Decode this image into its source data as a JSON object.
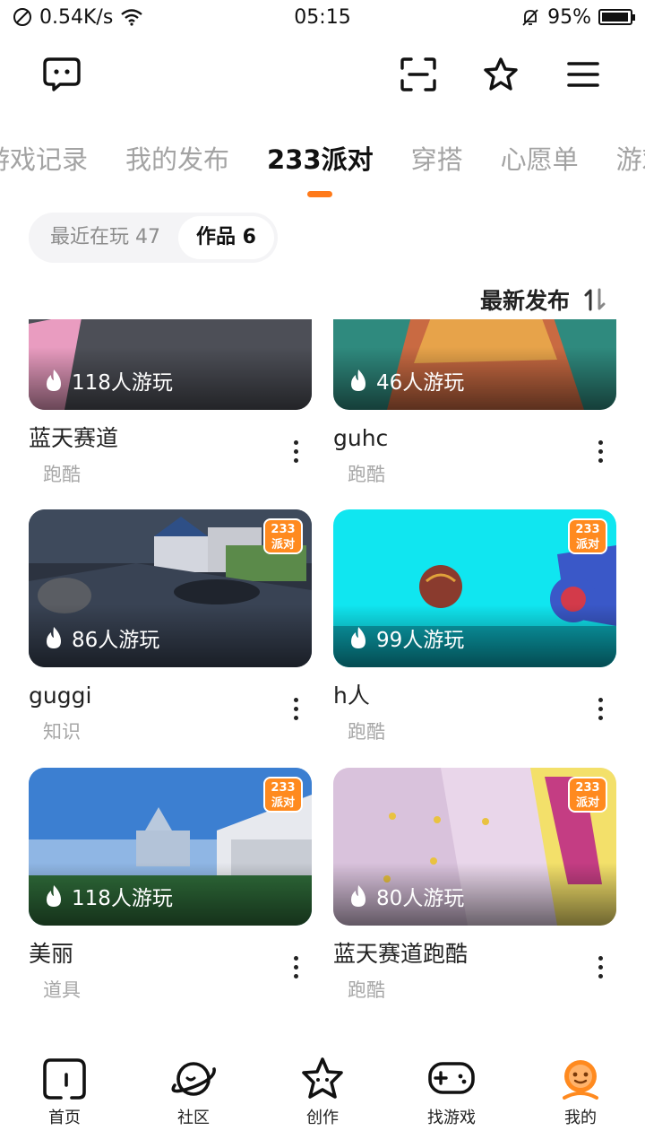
{
  "status": {
    "net_speed": "0.54K/s",
    "time": "05:15",
    "battery_pct": "95%",
    "battery_level": 0.95
  },
  "tabs": [
    {
      "label": "游戏记录",
      "active": false
    },
    {
      "label": "我的发布",
      "active": false
    },
    {
      "label": "233派对",
      "active": true
    },
    {
      "label": "穿搭",
      "active": false
    },
    {
      "label": "心愿单",
      "active": false
    },
    {
      "label": "游戏",
      "active": false
    }
  ],
  "segment": {
    "recent": "最近在玩 47",
    "works": "作品 6"
  },
  "sort": {
    "label": "最新发布"
  },
  "badge": {
    "line1": "233",
    "line2": "派对"
  },
  "cards": [
    {
      "title": "蓝天赛道",
      "tag": "跑酷",
      "plays": "118人游玩",
      "badge": false
    },
    {
      "title": "guhc",
      "tag": "跑酷",
      "plays": "46人游玩",
      "badge": false
    },
    {
      "title": "guggi",
      "tag": "知识",
      "plays": "86人游玩",
      "badge": true
    },
    {
      "title": "h人",
      "tag": "跑酷",
      "plays": "99人游玩",
      "badge": true
    },
    {
      "title": "美丽",
      "tag": "道具",
      "plays": "118人游玩",
      "badge": true
    },
    {
      "title": "蓝天赛道跑酷",
      "tag": "跑酷",
      "plays": "80人游玩",
      "badge": true
    }
  ],
  "nav": [
    {
      "label": "首页",
      "icon": "home-icon"
    },
    {
      "label": "社区",
      "icon": "planet-icon"
    },
    {
      "label": "创作",
      "icon": "star-icon"
    },
    {
      "label": "找游戏",
      "icon": "gamepad-icon"
    },
    {
      "label": "我的",
      "icon": "profile-icon",
      "active": true
    }
  ],
  "colors": {
    "accent": "#ff7a1a"
  }
}
